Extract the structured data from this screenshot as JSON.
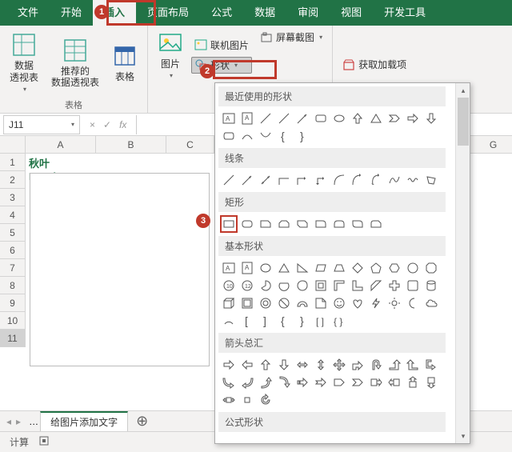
{
  "menubar": {
    "items": [
      "文件",
      "开始",
      "插入",
      "页面布局",
      "公式",
      "数据",
      "审阅",
      "视图",
      "开发工具"
    ],
    "active_index": 2
  },
  "ribbon": {
    "group_tables": {
      "pivot": "数据\n透视表",
      "recommended": "推荐的\n数据透视表",
      "table": "表格",
      "label": "表格"
    },
    "group_illustrations": {
      "picture": "图片",
      "online_pic": "联机图片",
      "shapes": "形状",
      "screenshot": "屏幕截图"
    },
    "group_addins": {
      "get_addins": "获取加载项"
    }
  },
  "formula_bar": {
    "name_box": "J11",
    "cancel": "×",
    "accept": "✓",
    "fx": "fx",
    "value": ""
  },
  "grid": {
    "columns": [
      "A",
      "B",
      "C",
      "G"
    ],
    "rows": [
      "1",
      "2",
      "3",
      "4",
      "5",
      "6",
      "7",
      "8",
      "9",
      "10",
      "11"
    ],
    "selected_row": 11,
    "a1_text": "秋叶Excel"
  },
  "sheet_tabs": {
    "ellipsis": "…",
    "active": "给图片添加文字"
  },
  "status_bar": {
    "label": "计算"
  },
  "badges": {
    "b1": "1",
    "b2": "2",
    "b3": "3"
  },
  "shapes_panel": {
    "sections": {
      "recent": "最近使用的形状",
      "lines": "线条",
      "rects": "矩形",
      "basic": "基本形状",
      "arrows": "箭头总汇",
      "formula": "公式形状"
    }
  }
}
